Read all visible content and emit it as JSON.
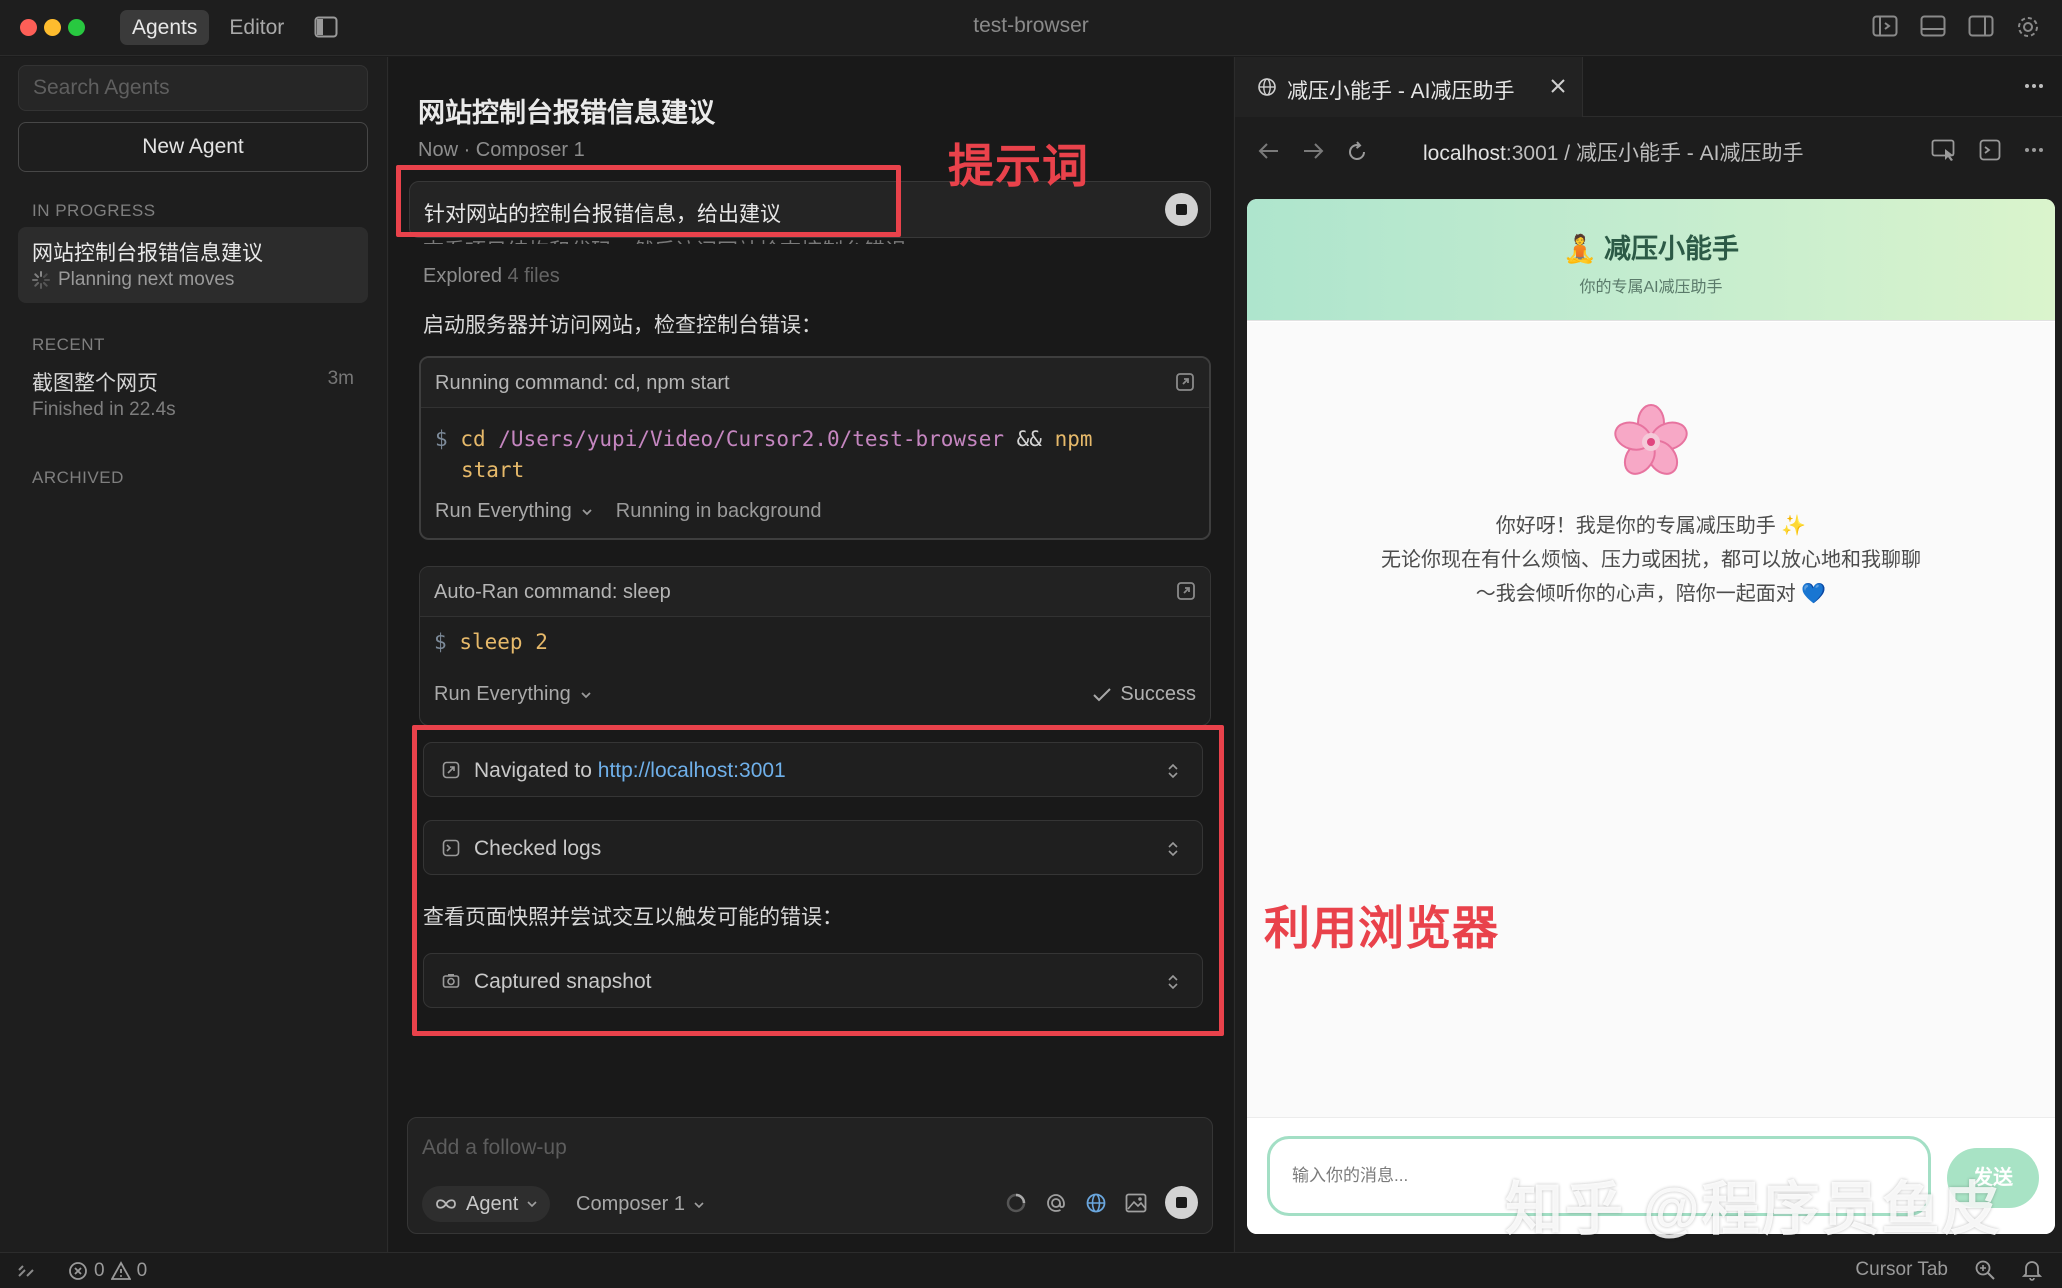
{
  "window": {
    "title": "test-browser",
    "modes": [
      "Agents",
      "Editor"
    ]
  },
  "sidebar": {
    "search_placeholder": "Search Agents",
    "new_agent": "New Agent",
    "in_progress_header": "IN PROGRESS",
    "in_progress_item": {
      "title": "网站控制台报错信息建议",
      "status": "Planning next moves"
    },
    "recent_header": "RECENT",
    "recent_item": {
      "title": "截图整个网页",
      "time": "3m",
      "status": "Finished in 22.4s"
    },
    "archived_header": "ARCHIVED"
  },
  "chat": {
    "title": "网站控制台报错信息建议",
    "meta": "Now · Composer 1",
    "prompt": "针对网站的控制台报错信息，给出建议",
    "prompt_cut_text": "查看项目结构和代码，然后访问网站检查控制台错误：",
    "explored_label": "Explored",
    "explored_count": "4 files",
    "step1_text": "启动服务器并访问网站，检查控制台错误：",
    "cmd1": {
      "header": "Running command: cd, npm start",
      "prompt_symbol": "$",
      "cmd": "cd",
      "path": "/Users/yupi/Video/Cursor2.0/test-browser",
      "op": "&&",
      "cmd2": "npm",
      "arg2": "start",
      "run_mode": "Run Everything",
      "status": "Running in background"
    },
    "cmd2": {
      "header": "Auto-Ran command: sleep",
      "prompt_symbol": "$",
      "cmd": "sleep",
      "arg": "2",
      "run_mode": "Run Everything",
      "status": "Success"
    },
    "tool_navigated": {
      "label": "Navigated to",
      "url": "http://localhost:3001"
    },
    "tool_checked_logs": "Checked logs",
    "step2_text": "查看页面快照并尝试交互以触发可能的错误：",
    "tool_snapshot": "Captured snapshot",
    "followup_placeholder": "Add a follow-up",
    "agent_pill": "Agent",
    "composer_select": "Composer 1"
  },
  "annotations": {
    "prompt_label": "提示词",
    "browser_label": "利用浏览器",
    "color": "#e9424b"
  },
  "browser": {
    "tab_title": "减压小能手 - AI减压助手",
    "url_host": "localhost",
    "url_rest": ":3001 / 减压小能手 - AI减压助手",
    "app": {
      "title": "🧘 减压小能手",
      "subtitle": "你的专属AI减压助手",
      "greeting_line1": "你好呀！我是你的专属减压助手 ✨",
      "greeting_line2": "无论你现在有什么烦恼、压力或困扰，都可以放心地和我聊聊",
      "greeting_line3": "～我会倾听你的心声，陪你一起面对 💙",
      "input_placeholder": "输入你的消息...",
      "send_label": "发送"
    }
  },
  "watermark": "知乎 @程序员鱼皮",
  "statusbar": {
    "errors": "0",
    "warnings": "0",
    "cursor_tab": "Cursor Tab"
  }
}
